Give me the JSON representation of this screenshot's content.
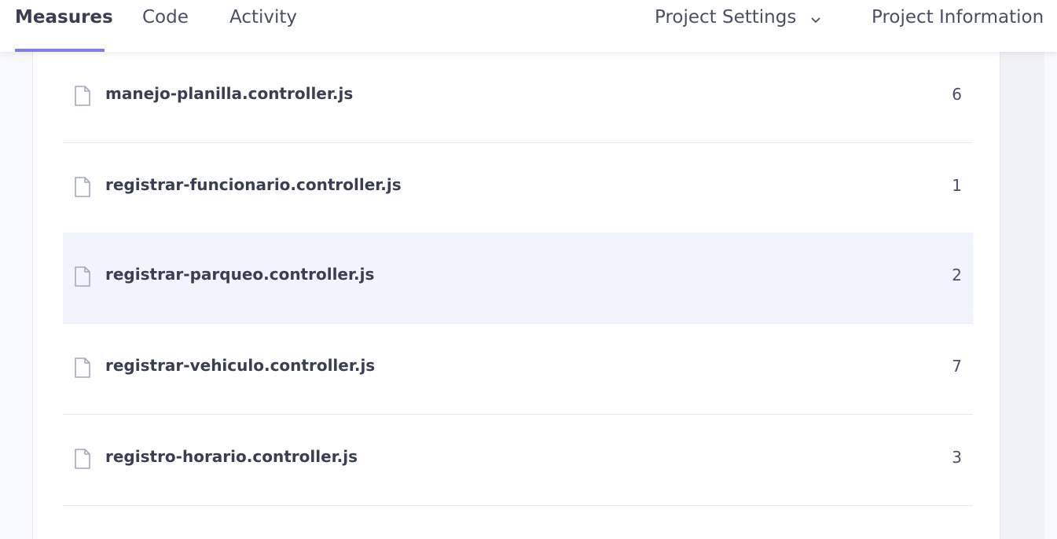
{
  "nav": {
    "tabs": [
      {
        "label": "Measures",
        "active": true
      },
      {
        "label": "Code",
        "active": false
      },
      {
        "label": "Activity",
        "active": false
      }
    ],
    "project_settings_label": "Project Settings",
    "project_information_label": "Project Information"
  },
  "files": [
    {
      "name": "manejo-planilla.controller.js",
      "count": "6",
      "icon": "file-icon"
    },
    {
      "name": "registrar-funcionario.controller.js",
      "count": "1",
      "icon": "file-icon"
    },
    {
      "name": "registrar-parqueo.controller.js",
      "count": "2",
      "icon": "file-icon",
      "highlighted": true
    },
    {
      "name": "registrar-vehiculo.controller.js",
      "count": "7",
      "icon": "file-icon"
    },
    {
      "name": "registro-horario.controller.js",
      "count": "3",
      "icon": "file-icon"
    }
  ],
  "colors": {
    "accent": "#7a84e0",
    "row_highlight": "#f1f4fd",
    "text": "#3a3e52"
  }
}
